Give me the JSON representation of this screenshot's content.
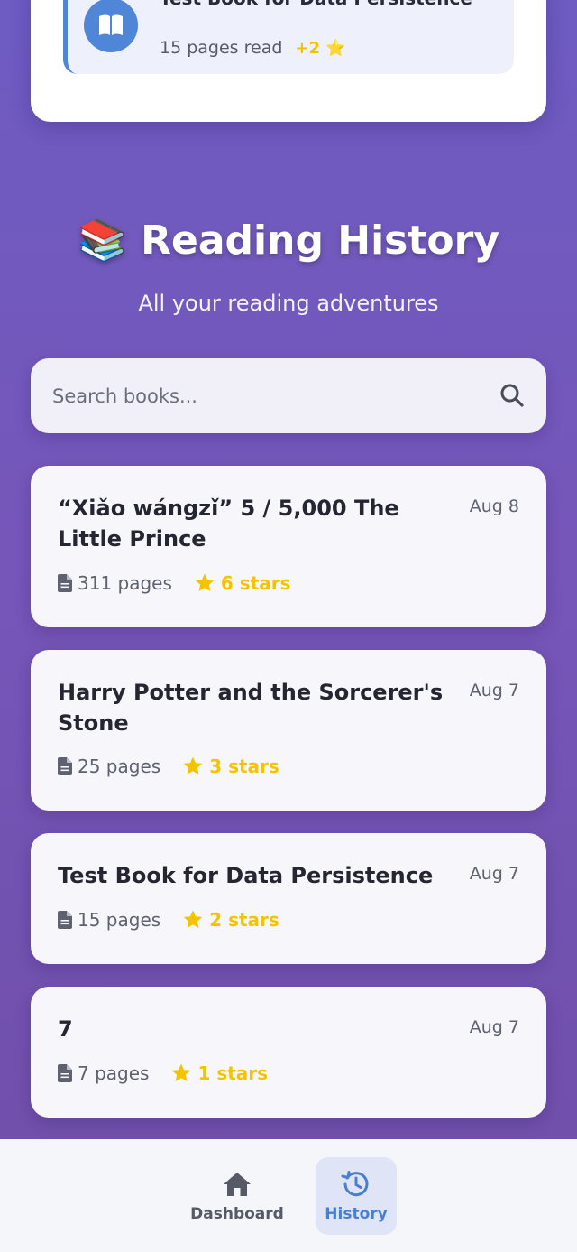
{
  "recent_activity": {
    "book_title": "Test Book for Data Persistence",
    "pages_read": "15 pages read",
    "stars_earned": "+2 ⭐",
    "icon": "book-open-icon"
  },
  "header": {
    "emoji": "📚",
    "title": "Reading History",
    "subtitle": "All your reading adventures"
  },
  "search": {
    "placeholder": "Search books...",
    "icon": "search-icon"
  },
  "books": [
    {
      "title": "“Xiǎo wángzǐ” 5 / 5,000 The Little Prince",
      "date": "Aug 8",
      "pages": "311 pages",
      "stars": "6 stars"
    },
    {
      "title": "Harry Potter and the Sorcerer's Stone",
      "date": "Aug 7",
      "pages": "25 pages",
      "stars": "3 stars"
    },
    {
      "title": "Test Book for Data Persistence",
      "date": "Aug 7",
      "pages": "15 pages",
      "stars": "2 stars"
    },
    {
      "title": "7",
      "date": "Aug 7",
      "pages": "7 pages",
      "stars": "1 stars"
    }
  ],
  "nav": {
    "dashboard_label": "Dashboard",
    "history_label": "History",
    "active": "History"
  },
  "colors": {
    "background": "#7256b8",
    "accent": "#4a7fd0",
    "star": "#f5c400"
  }
}
